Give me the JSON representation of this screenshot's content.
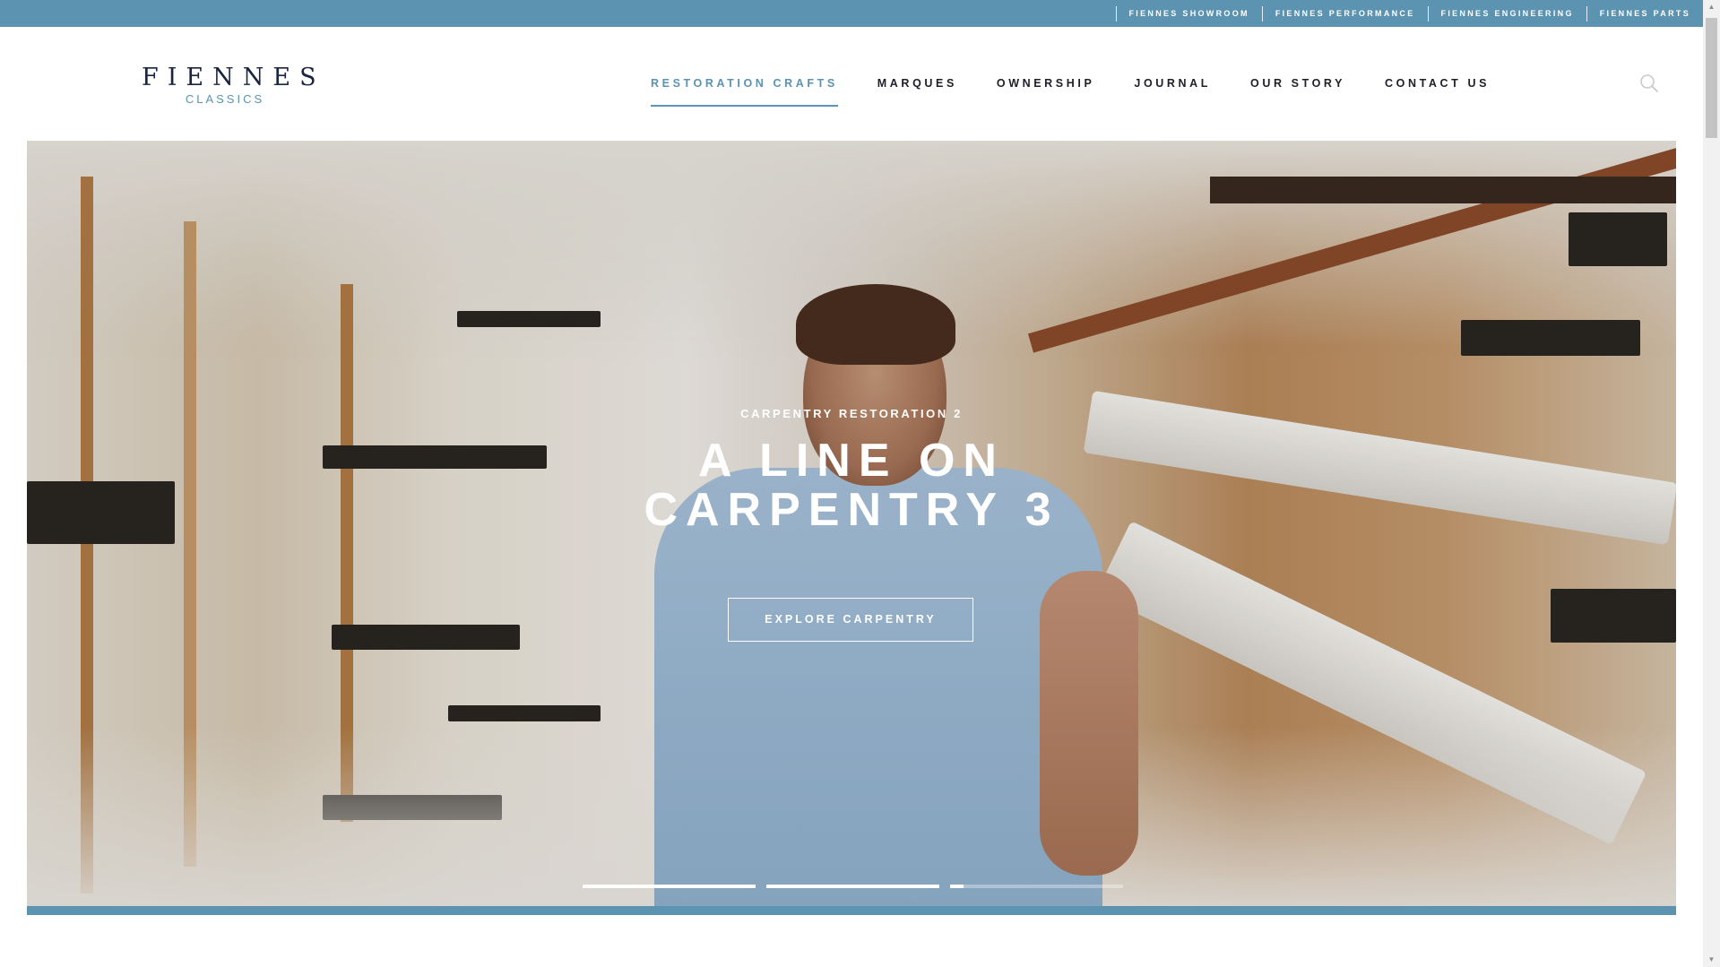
{
  "topbar": {
    "links": [
      "FIENNES SHOWROOM",
      "FIENNES PERFORMANCE",
      "FIENNES ENGINEERING",
      "FIENNES PARTS"
    ]
  },
  "logo": {
    "name": "FIENNES",
    "subtitle": "CLASSICS"
  },
  "nav": {
    "items": [
      "RESTORATION CRAFTS",
      "MARQUES",
      "OWNERSHIP",
      "JOURNAL",
      "OUR STORY",
      "CONTACT US"
    ],
    "active_index": 0
  },
  "search": {
    "icon": "search-icon"
  },
  "hero": {
    "eyebrow": "CARPENTRY RESTORATION 2",
    "headline_line1": "A LINE ON",
    "headline_line2": "CARPENTRY 3",
    "cta_label": "EXPLORE CARPENTRY",
    "slides_progress": [
      1.0,
      1.0,
      0.08
    ]
  },
  "colors": {
    "accent": "#5b93b0",
    "logo_navy": "#1a2540",
    "nav_text": "#1e1e28"
  }
}
